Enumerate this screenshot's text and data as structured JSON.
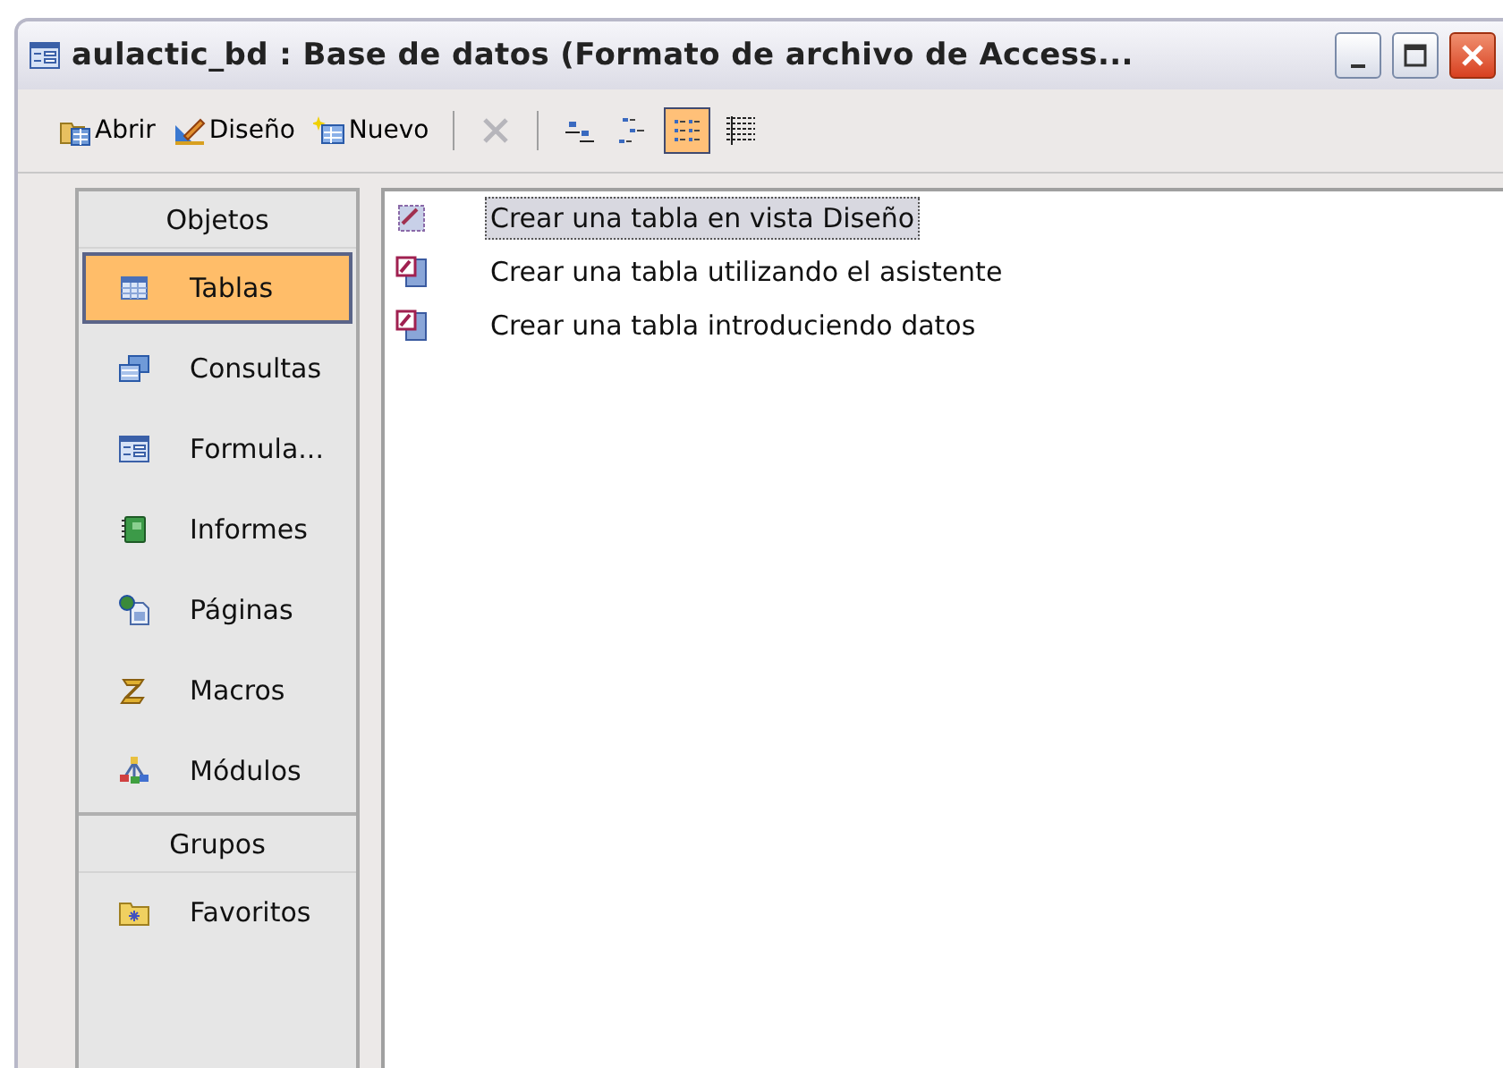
{
  "window": {
    "title": "aulactic_bd : Base de datos (Formato de archivo de Access..."
  },
  "toolbar": [
    {
      "kind": "command",
      "label": "Abrir",
      "disabled": false
    },
    {
      "kind": "command",
      "label": "Diseño",
      "disabled": false
    },
    {
      "kind": "command",
      "label": "Nuevo",
      "disabled": false
    },
    {
      "kind": "separator"
    },
    {
      "kind": "icon",
      "disabled": true,
      "selected": false
    },
    {
      "kind": "separator"
    },
    {
      "kind": "icon",
      "disabled": false,
      "selected": false
    },
    {
      "kind": "icon",
      "disabled": false,
      "selected": false
    },
    {
      "kind": "icon",
      "disabled": false,
      "selected": true
    },
    {
      "kind": "icon",
      "disabled": false,
      "selected": false
    }
  ],
  "sidebar": {
    "sections": [
      {
        "title": "Objetos",
        "items": [
          {
            "label": "Tablas",
            "selected": true
          },
          {
            "label": "Consultas",
            "selected": false
          },
          {
            "label": "Formula...",
            "selected": false
          },
          {
            "label": "Informes",
            "selected": false
          },
          {
            "label": "Páginas",
            "selected": false
          },
          {
            "label": "Macros",
            "selected": false
          },
          {
            "label": "Módulos",
            "selected": false
          }
        ]
      },
      {
        "title": "Grupos",
        "items": [
          {
            "label": "Favoritos",
            "selected": false
          }
        ]
      }
    ]
  },
  "list": {
    "items": [
      {
        "label": "Crear una tabla en vista Diseño",
        "selected": true
      },
      {
        "label": "Crear una tabla utilizando el asistente",
        "selected": false
      },
      {
        "label": "Crear una tabla introduciendo datos",
        "selected": false
      }
    ]
  }
}
